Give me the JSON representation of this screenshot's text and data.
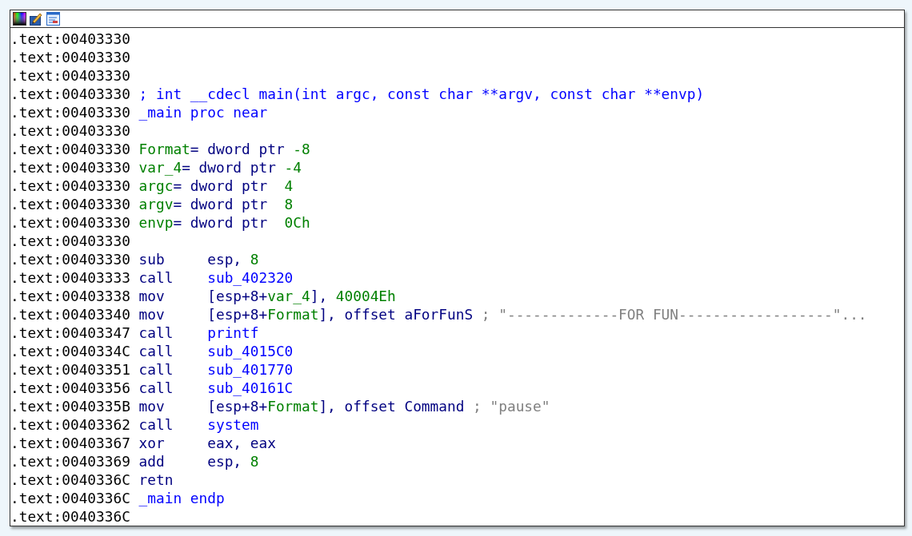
{
  "lines": [
    {
      "address": ".text:00403330"
    },
    {
      "address": ".text:00403330"
    },
    {
      "address": ".text:00403330"
    },
    {
      "address": ".text:00403330",
      "segments": [
        {
          "text": "; int __cdecl main(int argc, const char **argv, const char **envp)",
          "kind": "name"
        }
      ]
    },
    {
      "address": ".text:00403330",
      "segments": [
        {
          "text": "_main proc near",
          "kind": "name"
        }
      ]
    },
    {
      "address": ".text:00403330"
    },
    {
      "address": ".text:00403330",
      "segments": [
        {
          "text": "Format",
          "kind": "local"
        },
        {
          "text": "= dword ptr ",
          "kind": "plain"
        },
        {
          "text": "-8",
          "kind": "number"
        }
      ]
    },
    {
      "address": ".text:00403330",
      "segments": [
        {
          "text": "var_4",
          "kind": "local"
        },
        {
          "text": "= dword ptr ",
          "kind": "plain"
        },
        {
          "text": "-4",
          "kind": "number"
        }
      ]
    },
    {
      "address": ".text:00403330",
      "segments": [
        {
          "text": "argc",
          "kind": "local"
        },
        {
          "text": "= dword ptr  ",
          "kind": "plain"
        },
        {
          "text": "4",
          "kind": "number"
        }
      ]
    },
    {
      "address": ".text:00403330",
      "segments": [
        {
          "text": "argv",
          "kind": "local"
        },
        {
          "text": "= dword ptr  ",
          "kind": "plain"
        },
        {
          "text": "8",
          "kind": "number"
        }
      ]
    },
    {
      "address": ".text:00403330",
      "segments": [
        {
          "text": "envp",
          "kind": "local"
        },
        {
          "text": "= dword ptr  ",
          "kind": "plain"
        },
        {
          "text": "0Ch",
          "kind": "number"
        }
      ]
    },
    {
      "address": ".text:00403330"
    },
    {
      "address": ".text:00403330",
      "segments": [
        {
          "text": "sub",
          "kind": "mnemonic"
        },
        {
          "text": "esp, ",
          "kind": "plain"
        },
        {
          "text": "8",
          "kind": "number"
        }
      ]
    },
    {
      "address": ".text:00403333",
      "segments": [
        {
          "text": "call",
          "kind": "mnemonic"
        },
        {
          "text": "sub_402320",
          "kind": "name"
        }
      ]
    },
    {
      "address": ".text:00403338",
      "segments": [
        {
          "text": "mov",
          "kind": "mnemonic"
        },
        {
          "text": "[esp+8+",
          "kind": "plain"
        },
        {
          "text": "var_4",
          "kind": "local"
        },
        {
          "text": "], ",
          "kind": "plain"
        },
        {
          "text": "40004Eh",
          "kind": "number"
        }
      ]
    },
    {
      "address": ".text:00403340",
      "segments": [
        {
          "text": "mov",
          "kind": "mnemonic"
        },
        {
          "text": "[esp+8+",
          "kind": "plain"
        },
        {
          "text": "Format",
          "kind": "local"
        },
        {
          "text": "], offset aForFunS ",
          "kind": "plain"
        },
        {
          "text": "; \"-------------FOR FUN------------------\"...",
          "kind": "comment"
        }
      ]
    },
    {
      "address": ".text:00403347",
      "segments": [
        {
          "text": "call",
          "kind": "mnemonic"
        },
        {
          "text": "printf",
          "kind": "name"
        }
      ]
    },
    {
      "address": ".text:0040334C",
      "segments": [
        {
          "text": "call",
          "kind": "mnemonic"
        },
        {
          "text": "sub_4015C0",
          "kind": "name"
        }
      ]
    },
    {
      "address": ".text:00403351",
      "segments": [
        {
          "text": "call",
          "kind": "mnemonic"
        },
        {
          "text": "sub_401770",
          "kind": "name"
        }
      ]
    },
    {
      "address": ".text:00403356",
      "segments": [
        {
          "text": "call",
          "kind": "mnemonic"
        },
        {
          "text": "sub_40161C",
          "kind": "name"
        }
      ]
    },
    {
      "address": ".text:0040335B",
      "segments": [
        {
          "text": "mov",
          "kind": "mnemonic"
        },
        {
          "text": "[esp+8+",
          "kind": "plain"
        },
        {
          "text": "Format",
          "kind": "local"
        },
        {
          "text": "], offset Command ",
          "kind": "plain"
        },
        {
          "text": "; \"pause\"",
          "kind": "comment"
        }
      ]
    },
    {
      "address": ".text:00403362",
      "segments": [
        {
          "text": "call",
          "kind": "mnemonic"
        },
        {
          "text": "system",
          "kind": "name"
        }
      ]
    },
    {
      "address": ".text:00403367",
      "segments": [
        {
          "text": "xor",
          "kind": "mnemonic"
        },
        {
          "text": "eax, eax",
          "kind": "plain"
        }
      ]
    },
    {
      "address": ".text:00403369",
      "segments": [
        {
          "text": "add",
          "kind": "mnemonic"
        },
        {
          "text": "esp, ",
          "kind": "plain"
        },
        {
          "text": "8",
          "kind": "number"
        }
      ]
    },
    {
      "address": ".text:0040336C",
      "segments": [
        {
          "text": "retn",
          "kind": "mnemonic"
        }
      ]
    },
    {
      "address": ".text:0040336C",
      "segments": [
        {
          "text": "_main endp",
          "kind": "name"
        }
      ]
    },
    {
      "address": ".text:0040336C"
    }
  ]
}
